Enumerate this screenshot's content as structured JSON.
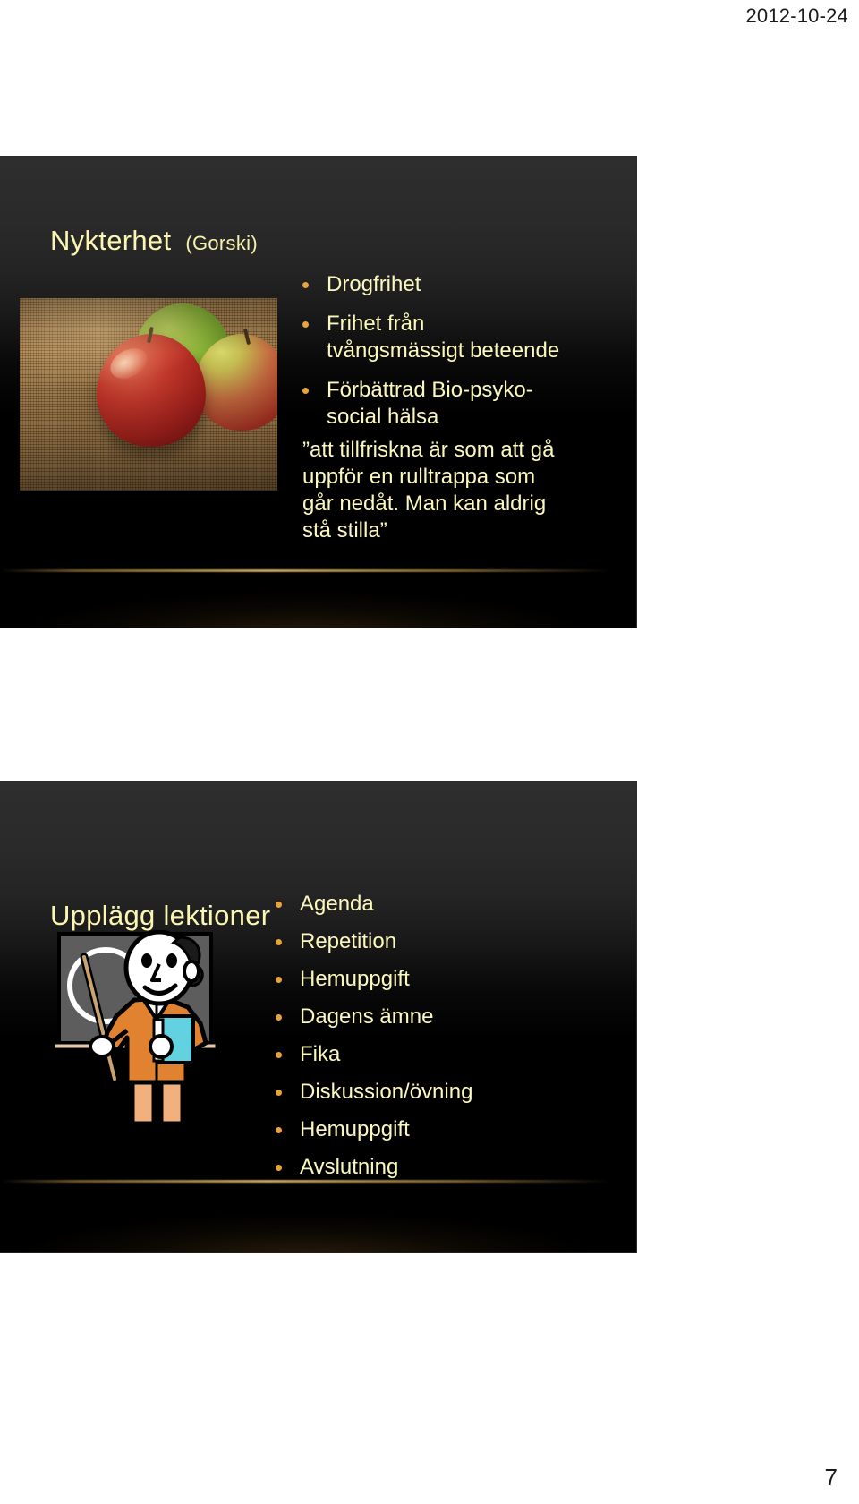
{
  "document": {
    "date": "2012-10-24",
    "page_number": "7"
  },
  "colors": {
    "title_yellow": "#fbf6b0",
    "body_yellow": "#fcf8bd",
    "bullet_marker": "#e8a33d",
    "slide_background": "#000000",
    "page_background": "#ffffff",
    "glow_line": "#e6be6e"
  },
  "slides": [
    {
      "title": "Nykterhet",
      "title_suffix": "(Gorski)",
      "image": {
        "name": "apples-on-burlap-photo",
        "description": "Three apples on burlap cloth"
      },
      "bullets": [
        "Drogfrihet",
        "Frihet från tvångsmässigt beteende",
        "Förbättrad Bio-psyko-social hälsa"
      ],
      "quote": "”att tillfriskna är som att gå uppför en rulltrappa som går nedåt. Man kan aldrig stå stilla”"
    },
    {
      "title": "Upplägg lektioner",
      "title_suffix": "",
      "image": {
        "name": "teacher-at-chalkboard-clipart",
        "description": "Teacher with pointer at chalkboard holding a book"
      },
      "bullets": [
        "Agenda",
        "Repetition",
        "Hemuppgift",
        "Dagens ämne",
        "Fika",
        "Diskussion/övning",
        "Hemuppgift",
        "Avslutning"
      ]
    }
  ]
}
